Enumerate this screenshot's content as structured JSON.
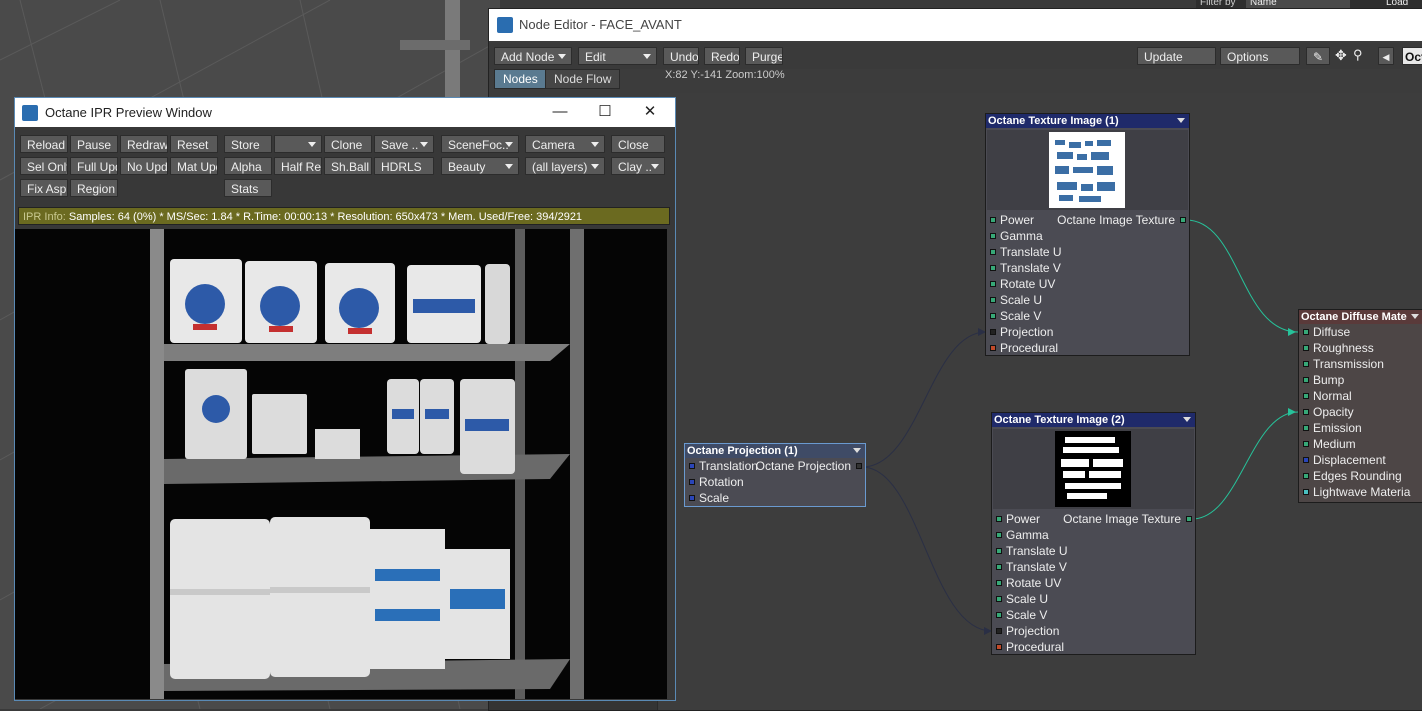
{
  "header": {
    "filter_by_label": "Filter by",
    "filter_by_value": "Name",
    "load_label": "Load"
  },
  "node_editor": {
    "title": "Node Editor - FACE_AVANT",
    "toolbar": {
      "add_node": "Add Node",
      "edit": "Edit",
      "undo": "Undo",
      "redo": "Redo",
      "purge": "Purge",
      "update": "Update",
      "options": "Options",
      "right_tab": "Oct"
    },
    "tabs": [
      "Nodes",
      "Node Flow"
    ],
    "coords": "X:82 Y:-141 Zoom:100%",
    "nodes": {
      "tex1": {
        "title": "Octane Texture Image (1)",
        "output": "Octane Image Texture",
        "inputs": [
          "Power",
          "Gamma",
          "Translate U",
          "Translate V",
          "Rotate UV",
          "Scale U",
          "Scale V",
          "Projection",
          "Procedural"
        ]
      },
      "tex2": {
        "title": "Octane Texture Image (2)",
        "output": "Octane Image Texture",
        "inputs": [
          "Power",
          "Gamma",
          "Translate U",
          "Translate V",
          "Rotate UV",
          "Scale U",
          "Scale V",
          "Projection",
          "Procedural"
        ]
      },
      "proj": {
        "title": "Octane Projection (1)",
        "output": "Octane Projection",
        "inputs": [
          "Translation",
          "Rotation",
          "Scale"
        ]
      },
      "diffuse": {
        "title": "Octane Diffuse Mate",
        "inputs": [
          "Diffuse",
          "Roughness",
          "Transmission",
          "Bump",
          "Normal",
          "Opacity",
          "Emission",
          "Medium",
          "Displacement",
          "Edges Rounding",
          "Lightwave Materia"
        ]
      }
    }
  },
  "ipr": {
    "title": "Octane IPR Preview Window",
    "buttons": {
      "reload": "Reload",
      "pause": "Pause",
      "redraw": "Redraw",
      "reset": "Reset",
      "store": "Store",
      "store_dd": "",
      "clone": "Clone",
      "save": "Save ..",
      "scene_focus": "SceneFoc..",
      "camera": "Camera",
      "close": "Close",
      "sel_only": "Sel Only",
      "full_upd": "Full Upd.",
      "no_upd": "No Upd.",
      "mat_upd": "Mat Upd",
      "alpha": "Alpha",
      "half_res": "Half Res",
      "sh_ball": "Sh.Ball",
      "hdrls": "HDRLS",
      "beauty": "Beauty",
      "all_layers": "(all layers)",
      "clay": "Clay ..",
      "fix_asp": "Fix Asp.",
      "region": "Region",
      "stats": "Stats"
    },
    "info_label": "IPR Info:",
    "info_text": "Samples: 64 (0%)  *  MS/Sec: 1.84  *  R.Time: 00:00:13  *  Resolution: 650x473  *  Mem. Used/Free: 394/2921"
  }
}
